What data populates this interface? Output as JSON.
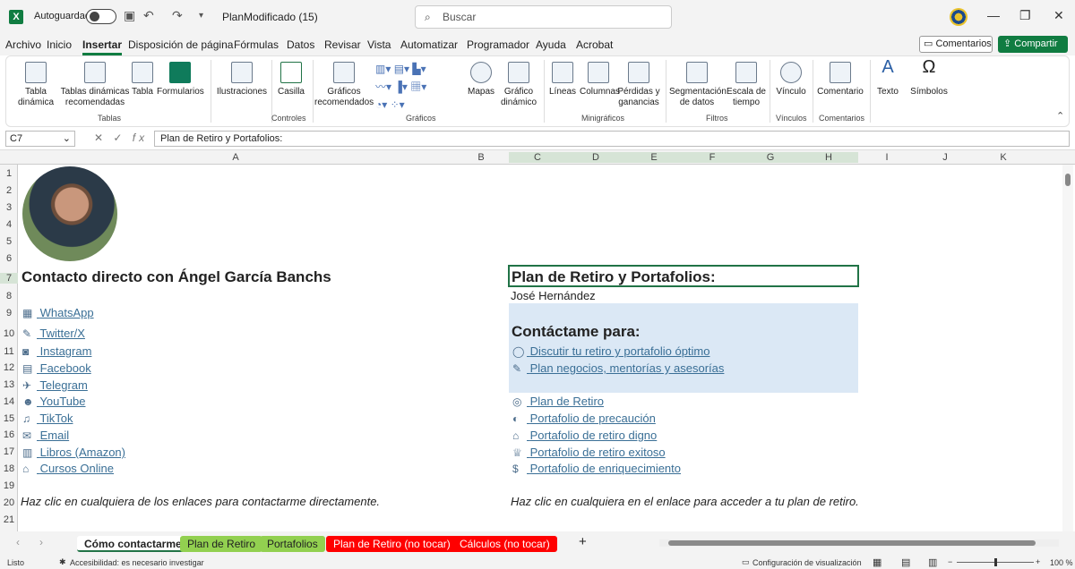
{
  "window": {
    "autosave_label": "Autoguardado",
    "doc_name": "PlanModificado (15)",
    "search_placeholder": "Buscar"
  },
  "menu": [
    "Archivo",
    "Inicio",
    "Insertar",
    "Disposición de página",
    "Fórmulas",
    "Datos",
    "Revisar",
    "Vista",
    "Automatizar",
    "Programador",
    "Ayuda",
    "Acrobat"
  ],
  "menu_active": "Insertar",
  "header_buttons": {
    "comments": "Comentarios",
    "share": "Compartir"
  },
  "ribbon": {
    "items": [
      "Tabla dinámica",
      "Tablas dinámicas recomendadas",
      "Tabla",
      "Formularios",
      "Ilustraciones",
      "Casilla",
      "Gráficos recomendados",
      "Mapas",
      "Gráfico dinámico",
      "Líneas",
      "Columnas",
      "Pérdidas y ganancias",
      "Segmentación de datos",
      "Escala de tiempo",
      "Vínculo",
      "Comentario",
      "Texto",
      "Símbolos"
    ],
    "groups": [
      "Tablas",
      "Controles",
      "Gráficos",
      "Minigráficos",
      "Filtros",
      "Vínculos",
      "Comentarios"
    ]
  },
  "formula_bar": {
    "name_box": "C7",
    "fx": "fx",
    "value": "Plan de Retiro y Portafolios:"
  },
  "columns": [
    "A",
    "B",
    "C",
    "D",
    "E",
    "F",
    "G",
    "H",
    "I",
    "J",
    "K"
  ],
  "rows": [
    "1",
    "2",
    "3",
    "4",
    "5",
    "6",
    "7",
    "8",
    "9",
    "10",
    "11",
    "12",
    "13",
    "14",
    "15",
    "16",
    "17",
    "18",
    "19",
    "20",
    "21"
  ],
  "sheet": {
    "left_title": "Contacto directo con Ángel García Banchs",
    "left_links": [
      {
        "icon": "phone-icon",
        "glyph": "▦",
        "label": "WhatsApp"
      },
      {
        "icon": "bird-icon",
        "glyph": "✎",
        "label": "Twitter/X"
      },
      {
        "icon": "camera-icon",
        "glyph": "◙",
        "label": "Instagram"
      },
      {
        "icon": "book-icon",
        "glyph": "▤",
        "label": "Facebook"
      },
      {
        "icon": "plane-icon",
        "glyph": "✈",
        "label": "Telegram"
      },
      {
        "icon": "people-icon",
        "glyph": "☻",
        "label": "YouTube"
      },
      {
        "icon": "music-icon",
        "glyph": "♫",
        "label": "TikTok"
      },
      {
        "icon": "mail-icon",
        "glyph": "✉",
        "label": "Email"
      },
      {
        "icon": "books-icon",
        "glyph": "▥",
        "label": "Libros (Amazon)"
      },
      {
        "icon": "cap-icon",
        "glyph": "⌂",
        "label": "Cursos Online"
      }
    ],
    "left_footer": "Haz clic en cualquiera de los enlaces para contactarme directamente.",
    "right_title": "Plan de Retiro y Portafolios:",
    "right_name": "José Hernández",
    "contact_heading": "Contáctame para:",
    "contact_links": [
      {
        "icon": "chat-icon",
        "glyph": "◯",
        "label": "Discutir tu retiro y portafolio óptimo"
      },
      {
        "icon": "edit-icon",
        "glyph": "✎",
        "label": "Plan negocios, mentorías y asesorías"
      }
    ],
    "plan_links": [
      {
        "icon": "target-icon",
        "glyph": "◎",
        "label": "Plan de Retiro"
      },
      {
        "icon": "shield-icon",
        "glyph": "◐",
        "label": "Portafolio de precaución"
      },
      {
        "icon": "house-icon",
        "glyph": "⌂",
        "label": "Portafolio de retiro digno"
      },
      {
        "icon": "trophy-icon",
        "glyph": "♕",
        "label": "Portafolio de retiro exitoso"
      },
      {
        "icon": "moneybag-icon",
        "glyph": "$",
        "label": "Portafolio de enriquecimiento"
      }
    ],
    "right_footer": "Haz clic en cualquiera en el enlace para acceder a tu plan de retiro."
  },
  "tabs": [
    {
      "label": "Cómo contactarme",
      "color": "#ffffff",
      "text": "#222222",
      "active": true
    },
    {
      "label": "Plan de Retiro",
      "color": "#92d050",
      "text": "#222222"
    },
    {
      "label": "Portafolios",
      "color": "#92d050",
      "text": "#222222"
    },
    {
      "label": "Plan de Retiro (no tocar)",
      "color": "#ff0000",
      "text": "#ffffff"
    },
    {
      "label": "Cálculos (no tocar)",
      "color": "#ff0000",
      "text": "#ffffff"
    }
  ],
  "status": {
    "ready": "Listo",
    "accessibility": "Accesibilidad: es necesario investigar",
    "display_settings": "Configuración de visualización",
    "zoom": "100 %"
  }
}
